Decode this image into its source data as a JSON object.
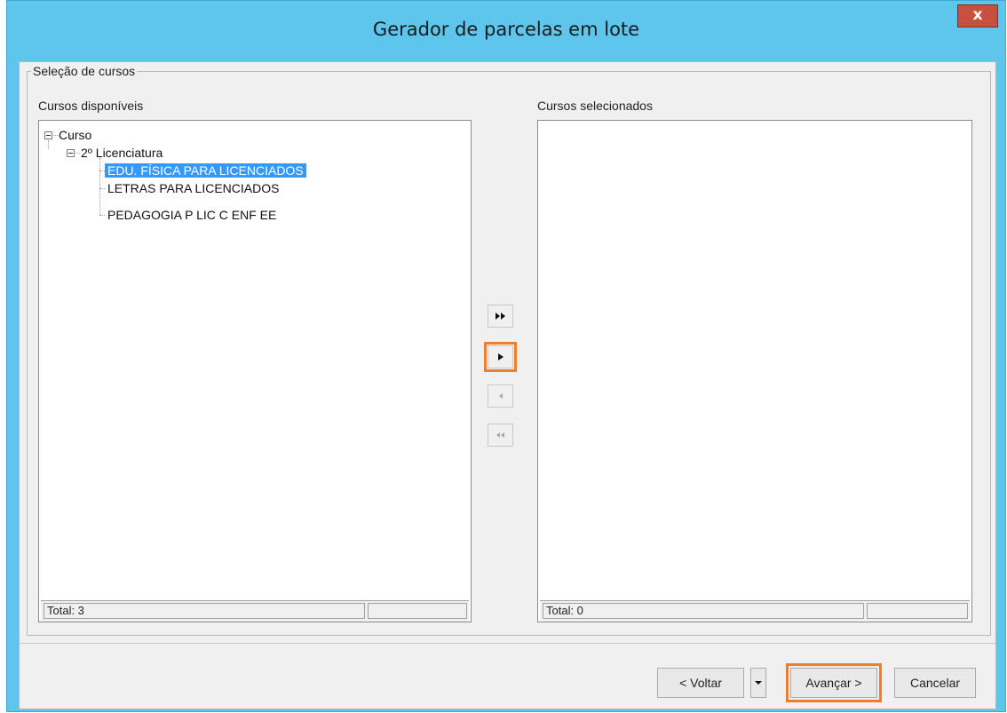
{
  "window": {
    "title": "Gerador de parcelas em lote",
    "close_label": "x"
  },
  "group": {
    "label": "Seleção de cursos"
  },
  "available": {
    "label": "Cursos disponíveis",
    "tree": {
      "root": "Curso",
      "category": "2º Licenciatura",
      "items": [
        "EDU. FÍSICA PARA LICENCIADOS",
        "LETRAS PARA LICENCIADOS",
        "PEDAGOGIA P LIC C ENF EE"
      ],
      "selected_item": "EDU. FÍSICA PARA LICENCIADOS"
    },
    "total": "Total: 3"
  },
  "selected": {
    "label": "Cursos selecionados",
    "total": "Total: 0"
  },
  "transfer_buttons": [
    {
      "icon": "double-right-arrow-icon",
      "enabled": true
    },
    {
      "icon": "right-arrow-icon",
      "enabled": true,
      "highlighted": true
    },
    {
      "icon": "left-arrow-icon",
      "enabled": false
    },
    {
      "icon": "double-left-arrow-icon",
      "enabled": false
    }
  ],
  "footer": {
    "back_label": "< Voltar",
    "next_label": "Avançar >",
    "cancel_label": "Cancelar"
  },
  "colors": {
    "titlebar": "#5ec6ec",
    "highlight": "#ef7d2a",
    "selection": "#3399ff",
    "close": "#c7503f"
  }
}
